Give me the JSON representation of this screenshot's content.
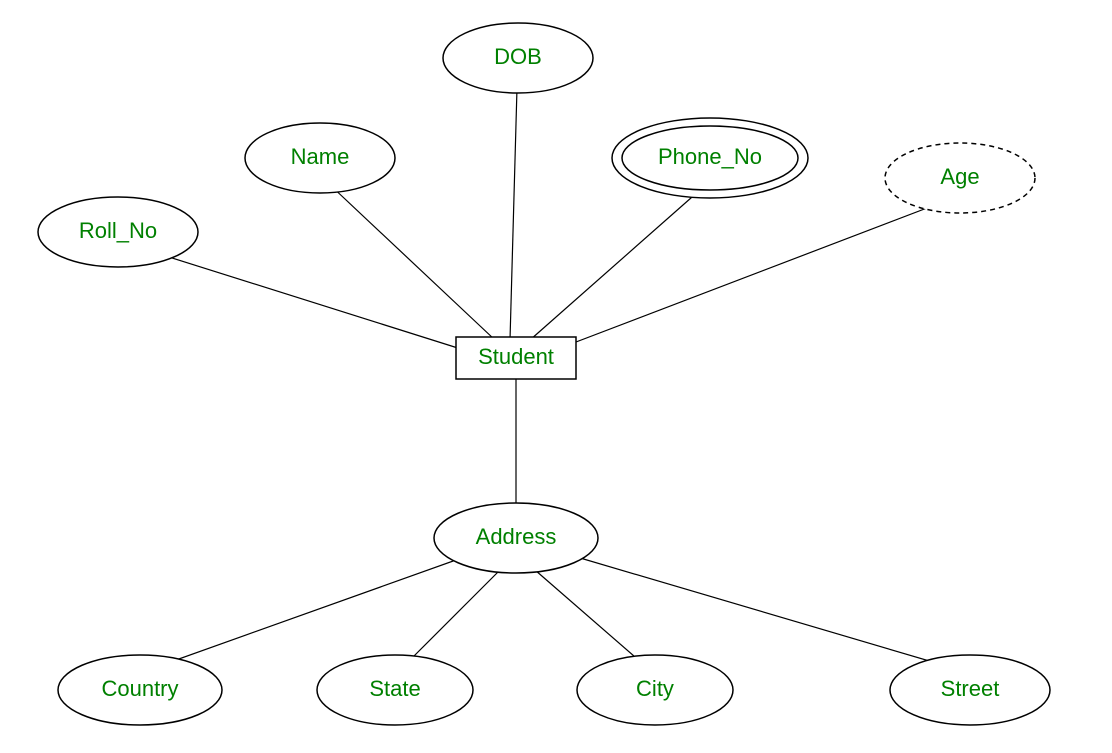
{
  "diagram": {
    "type": "er-diagram",
    "entity": {
      "label": "Student"
    },
    "attributes": {
      "roll_no": {
        "label": "Roll_No",
        "kind": "simple"
      },
      "name": {
        "label": "Name",
        "kind": "simple"
      },
      "dob": {
        "label": "DOB",
        "kind": "simple"
      },
      "phone_no": {
        "label": "Phone_No",
        "kind": "multivalued"
      },
      "age": {
        "label": "Age",
        "kind": "derived"
      },
      "address": {
        "label": "Address",
        "kind": "composite"
      }
    },
    "address_parts": {
      "country": {
        "label": "Country"
      },
      "state": {
        "label": "State"
      },
      "city": {
        "label": "City"
      },
      "street": {
        "label": "Street"
      }
    }
  }
}
